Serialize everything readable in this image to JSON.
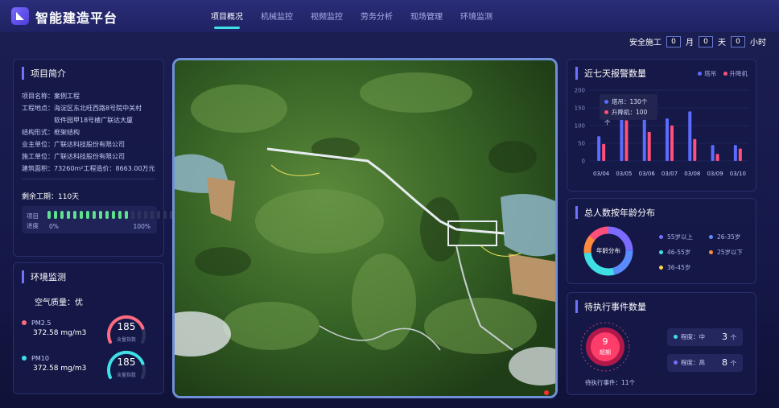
{
  "app": {
    "title": "智能建造平台"
  },
  "nav": [
    {
      "label": "项目概况",
      "active": true
    },
    {
      "label": "机械监控"
    },
    {
      "label": "视频监控"
    },
    {
      "label": "劳务分析"
    },
    {
      "label": "现场管理"
    },
    {
      "label": "环境监测"
    }
  ],
  "safety": {
    "label": "安全施工",
    "months": "0",
    "month_unit": "月",
    "days": "0",
    "day_unit": "天",
    "hours": "0",
    "hour_unit": "小时"
  },
  "project": {
    "title": "项目简介",
    "name": "项目名称：案例工程",
    "location1": "工程地点：海淀区东北旺西路8号院中关村",
    "location2": "软件园甲18号楼广联达大厦",
    "structure": "结构形式：框架结构",
    "owner": "业主单位：广联达科技股份有限公司",
    "builder": "施工单位：广联达科技股份有限公司",
    "area": "建筑面积：73260m²工程造价：8663.00万元",
    "remaining": "剩余工期：110天",
    "progress_label": "项目进度",
    "progress_min": "0%",
    "progress_max": "100%",
    "progress_fraction": 0.65
  },
  "env": {
    "title": "环境监测",
    "air": "空气质量：优",
    "pm25_label": "PM2.5",
    "pm25_value": "372.58 mg/m3",
    "pm25_index": "185",
    "pm25_index_label": "含量指数",
    "pm10_label": "PM10",
    "pm10_value": "372.58 mg/m3",
    "pm10_index": "185",
    "pm10_index_label": "含量指数",
    "colors": {
      "pm25": "#ff6b81",
      "pm10": "#3ee0e6"
    }
  },
  "chart_data": [
    {
      "type": "bar",
      "title": "近七天报警数量",
      "categories": [
        "03/04",
        "03/05",
        "03/06",
        "03/07",
        "03/08",
        "03/09",
        "03/10"
      ],
      "series": [
        {
          "name": "塔吊",
          "values": [
            70,
            160,
            130,
            120,
            140,
            45,
            45
          ],
          "color": "#5b6cff"
        },
        {
          "name": "升降机",
          "values": [
            48,
            115,
            82,
            100,
            62,
            20,
            35
          ],
          "color": "#ff4f7b"
        }
      ],
      "ylim": [
        0,
        200
      ],
      "yticks": [
        "0",
        "50",
        "100",
        "150",
        "200"
      ],
      "tooltip": {
        "series1": "塔吊：130个",
        "series2": "升降机：100个"
      }
    }
  ],
  "age": {
    "title": "总人数按年龄分布",
    "center": "年龄分布",
    "groups": [
      {
        "label": "55岁以上",
        "color": "#7b6bff"
      },
      {
        "label": "26-35岁",
        "color": "#5b8cff"
      },
      {
        "label": "46-55岁",
        "color": "#3ee0e6"
      },
      {
        "label": "25岁以下",
        "color": "#ff8a3d"
      },
      {
        "label": "36-45岁",
        "color": "#ffd24d"
      }
    ]
  },
  "events": {
    "title": "待执行事件数量",
    "overdue_count": "9",
    "overdue_label": "超期",
    "pending": "待执行事件：11个",
    "levels": [
      {
        "label": "程度：中",
        "count": "3",
        "unit": "个",
        "color": "#3ee0e6"
      },
      {
        "label": "程度：高",
        "count": "8",
        "unit": "个",
        "color": "#7b6bff"
      }
    ]
  }
}
